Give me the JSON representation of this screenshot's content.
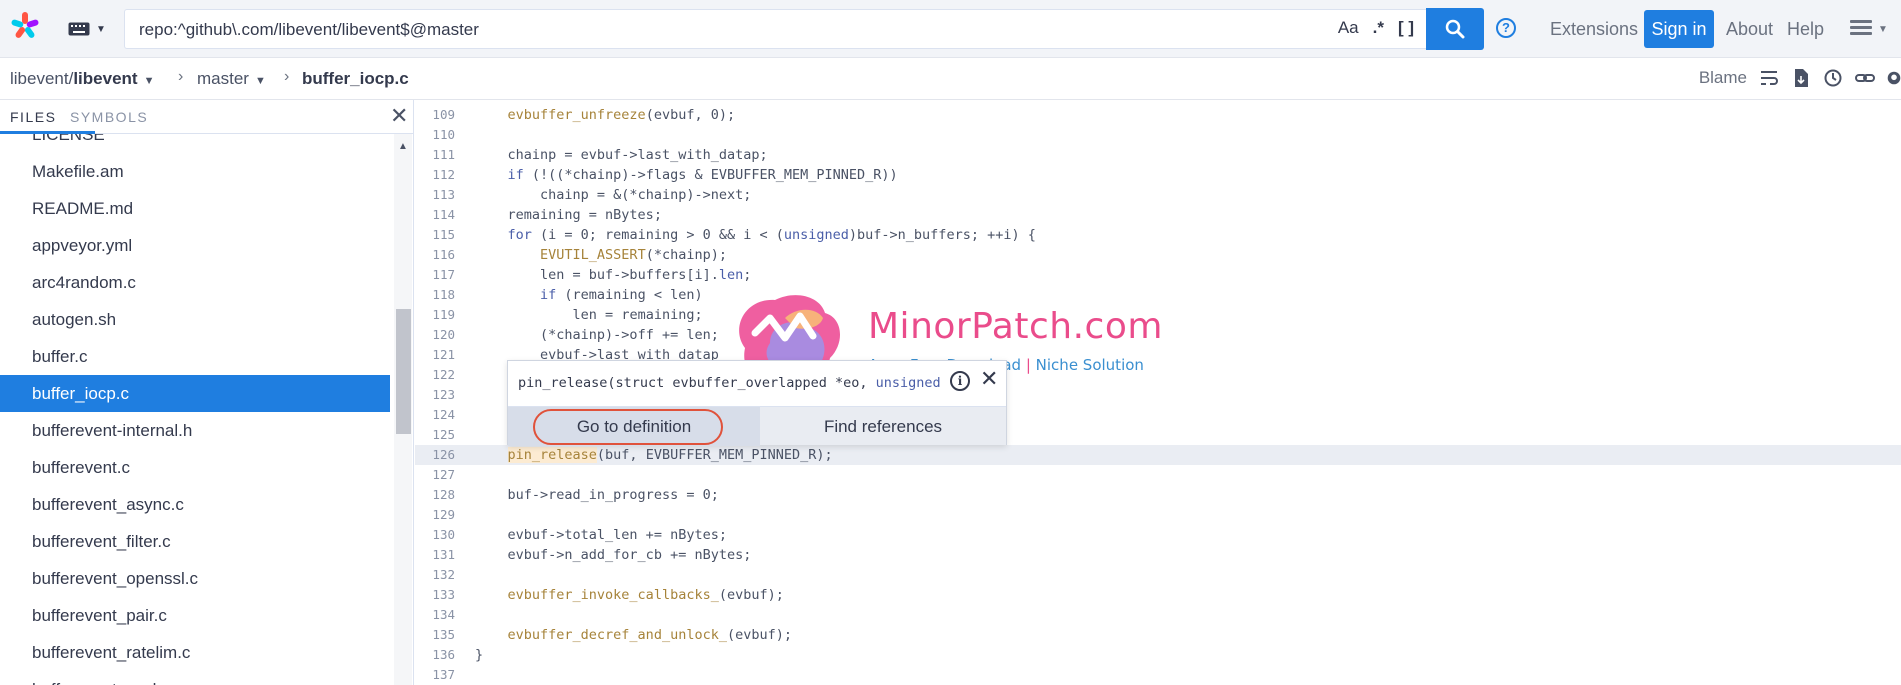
{
  "search": {
    "query": "repo:^github\\.com/libevent/libevent$@master",
    "case_toggle": "Aa",
    "regex_toggle": ".*",
    "structural_toggle": "[ ]"
  },
  "nav": {
    "extensions": "Extensions",
    "sign_in": "Sign in",
    "about": "About",
    "help": "Help"
  },
  "breadcrumb": {
    "org": "libevent/",
    "repo": "libevent",
    "branch": "master",
    "file": "buffer_iocp.c"
  },
  "toolbar": {
    "blame": "Blame"
  },
  "sidebar": {
    "tab_files": "FILES",
    "tab_symbols": "SYMBOLS",
    "files": [
      "LICENSE",
      "Makefile.am",
      "README.md",
      "appveyor.yml",
      "arc4random.c",
      "autogen.sh",
      "buffer.c",
      "buffer_iocp.c",
      "bufferevent-internal.h",
      "bufferevent.c",
      "bufferevent_async.c",
      "bufferevent_filter.c",
      "bufferevent_openssl.c",
      "bufferevent_pair.c",
      "bufferevent_ratelim.c",
      "bufferevent_sock.c"
    ],
    "selected_file": "buffer_iocp.c"
  },
  "code": {
    "lines": [
      {
        "n": "109",
        "html": "\t<span class=\"fn\">evbuffer_unfreeze</span>(evbuf, 0);"
      },
      {
        "n": "110",
        "html": ""
      },
      {
        "n": "111",
        "html": "\tchainp = evbuf->last_with_datap;"
      },
      {
        "n": "112",
        "html": "\t<span class=\"kw\">if</span> (!((*chainp)->flags &amp; EVBUFFER_MEM_PINNED_R))"
      },
      {
        "n": "113",
        "html": "\t\tchainp = &amp;(*chainp)->next;"
      },
      {
        "n": "114",
        "html": "\tremaining = nBytes;"
      },
      {
        "n": "115",
        "html": "\t<span class=\"kw\">for</span> (i = 0; remaining > 0 &amp;&amp; i &lt; (<span class=\"kw\">unsigned</span>)buf->n_buffers; ++i) {"
      },
      {
        "n": "116",
        "html": "\t\t<span class=\"fn\">EVUTIL_ASSERT</span>(*chainp);"
      },
      {
        "n": "117",
        "html": "\t\tlen = buf->buffers[i].<span class=\"kw\">len</span>;"
      },
      {
        "n": "118",
        "html": "\t\t<span class=\"kw\">if</span> (remaining &lt; len)"
      },
      {
        "n": "119",
        "html": "\t\t\tlen = remaining;"
      },
      {
        "n": "120",
        "html": "\t\t(*chainp)->off += len;"
      },
      {
        "n": "121",
        "html": "\t\tevbuf->last_with_datap"
      },
      {
        "n": "122",
        "html": ""
      },
      {
        "n": "123",
        "html": ""
      },
      {
        "n": "124",
        "html": ""
      },
      {
        "n": "125",
        "html": ""
      },
      {
        "n": "126",
        "html": "\t<span class=\"pin\">pin_release</span>(buf, EVBUFFER_MEM_PINNED_R);"
      },
      {
        "n": "127",
        "html": ""
      },
      {
        "n": "128",
        "html": "\tbuf->read_in_progress = 0;"
      },
      {
        "n": "129",
        "html": ""
      },
      {
        "n": "130",
        "html": "\tevbuf->total_len += nBytes;"
      },
      {
        "n": "131",
        "html": "\tevbuf->n_add_for_cb += nBytes;"
      },
      {
        "n": "132",
        "html": ""
      },
      {
        "n": "133",
        "html": "\t<span class=\"fn\">evbuffer_invoke_callbacks_</span>(evbuf);"
      },
      {
        "n": "134",
        "html": ""
      },
      {
        "n": "135",
        "html": "\t<span class=\"fn\">evbuffer_decref_and_unlock_</span>(evbuf);"
      },
      {
        "n": "136",
        "html": "}"
      },
      {
        "n": "137",
        "html": ""
      }
    ],
    "highlight_line": "126"
  },
  "popover": {
    "signature_prefix": "pin_release(struct evbuffer_overlapped *eo, ",
    "signature_kw": "unsigned",
    "go_to_definition": "Go to definition",
    "find_references": "Find references"
  },
  "watermark": {
    "title": "MinorPatch.com",
    "sub_left": "Apps Free Download",
    "sub_sep": "|",
    "sub_right": "Niche Solution"
  },
  "colors": {
    "accent": "#1f7ee0",
    "annotation_circle": "#e0523b",
    "watermark_pink": "#ea4c8b",
    "watermark_blue": "#3a8fd0"
  }
}
